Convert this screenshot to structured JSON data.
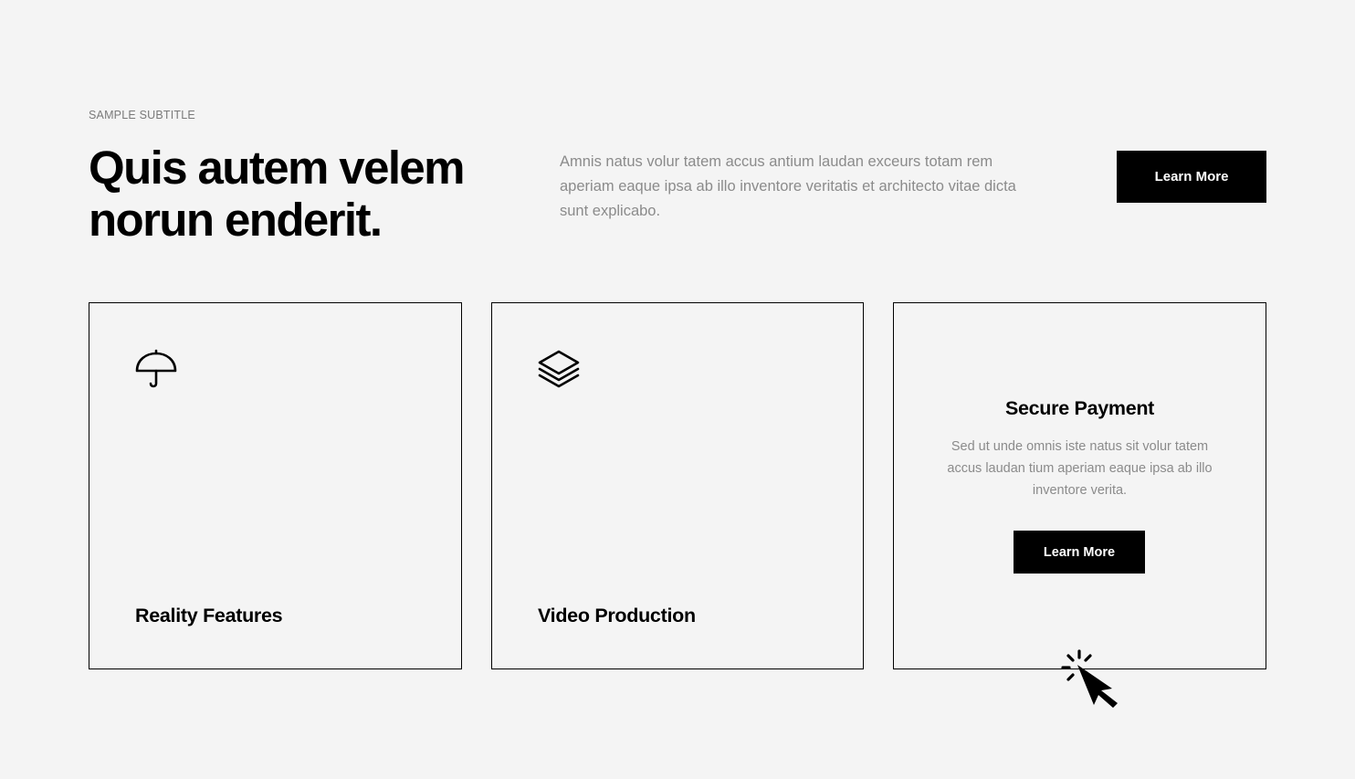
{
  "header": {
    "subtitle": "SAMPLE SUBTITLE",
    "title": "Quis autem velem norun enderit.",
    "description": "Amnis natus volur tatem accus antium laudan exceurs totam rem aperiam eaque ipsa ab illo inventore veritatis et architecto vitae dicta sunt explicabo.",
    "button_label": "Learn More"
  },
  "cards": [
    {
      "title": "Reality Features",
      "icon": "umbrella-icon"
    },
    {
      "title": "Video Production",
      "icon": "layers-icon"
    },
    {
      "title": "Secure Payment",
      "description": "Sed ut unde omnis iste natus sit volur tatem accus laudan tium aperiam eaque ipsa ab illo inventore verita.",
      "button_label": "Learn More",
      "state": "hover"
    }
  ],
  "cursor": {
    "icon": "pointer-click-icon"
  },
  "colors": {
    "background": "#f4f4f4",
    "text": "#000000",
    "muted_text": "#8b8b8b",
    "button_bg": "#000000",
    "button_text": "#ffffff"
  }
}
